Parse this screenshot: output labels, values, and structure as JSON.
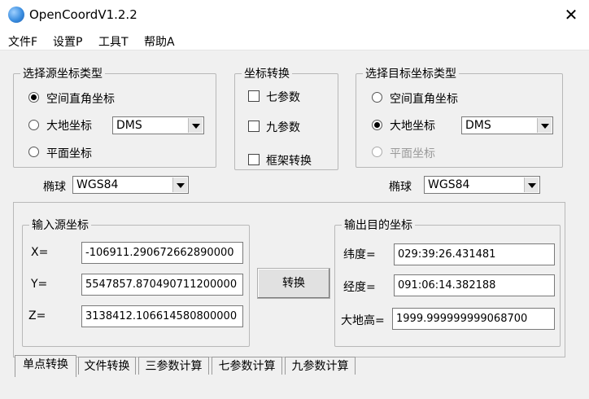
{
  "window": {
    "title": "OpenCoordV1.2.2"
  },
  "menu": [
    "文件F",
    "设置P",
    "工具T",
    "帮助A"
  ],
  "source_type": {
    "legend": "选择源坐标类型",
    "options": [
      "空间直角坐标",
      "大地坐标",
      "平面坐标"
    ],
    "selected": 0,
    "format_value": "DMS",
    "ellipsoid_label": "椭球",
    "ellipsoid_value": "WGS84"
  },
  "transform": {
    "legend": "坐标转换",
    "options": [
      "七参数",
      "九参数",
      "框架转换"
    ]
  },
  "target_type": {
    "legend": "选择目标坐标类型",
    "options": [
      "空间直角坐标",
      "大地坐标",
      "平面坐标"
    ],
    "selected": 1,
    "format_value": "DMS",
    "ellipsoid_label": "椭球",
    "ellipsoid_value": "WGS84"
  },
  "input": {
    "legend": "输入源坐标",
    "x_label": "X=",
    "x_value": "-106911.290672662890000",
    "y_label": "Y=",
    "y_value": "5547857.870490711200000",
    "z_label": "Z=",
    "z_value": "3138412.106614580800000"
  },
  "convert_button": "转换",
  "output": {
    "legend": "输出目的坐标",
    "lat_label": "纬度=",
    "lat_value": "029:39:26.431481",
    "lon_label": "经度=",
    "lon_value": "091:06:14.382188",
    "h_label": "大地高=",
    "h_value": "1999.999999999068700"
  },
  "tabs": [
    "单点转换",
    "文件转换",
    "三参数计算",
    "七参数计算",
    "九参数计算"
  ],
  "active_tab": 0
}
